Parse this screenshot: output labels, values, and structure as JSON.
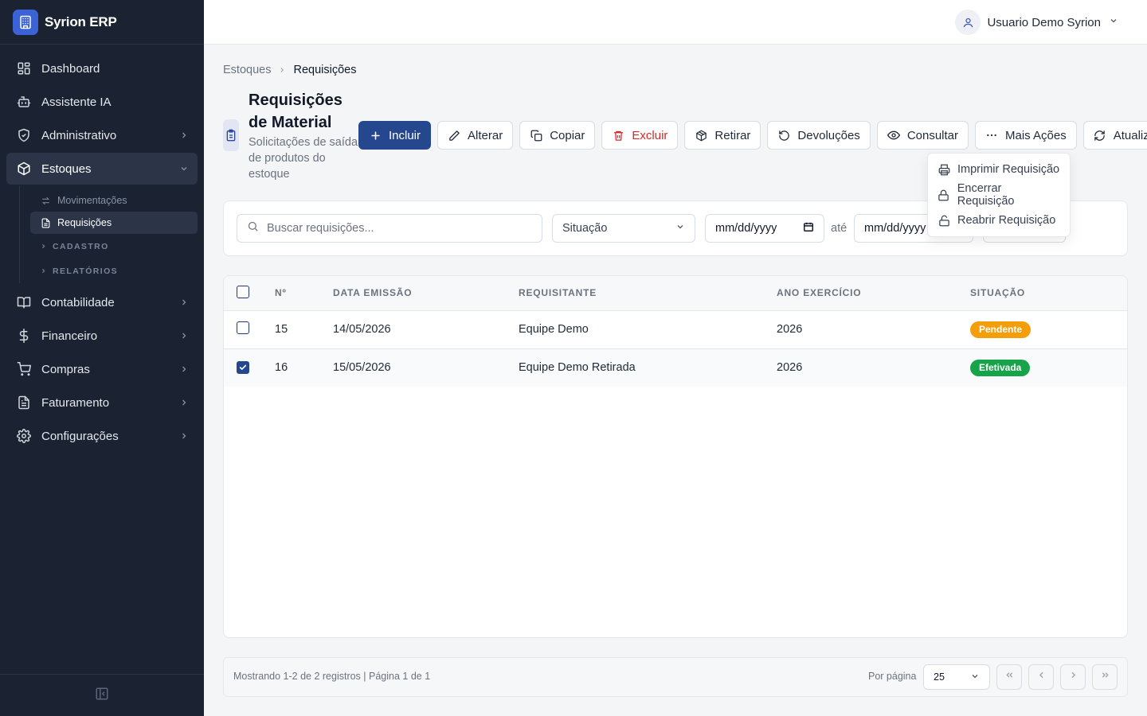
{
  "app": {
    "name": "Syrion ERP"
  },
  "sidebar": {
    "items": [
      {
        "label": "Dashboard",
        "icon": "dashboard-icon"
      },
      {
        "label": "Assistente IA",
        "icon": "bot-icon"
      },
      {
        "label": "Administrativo",
        "icon": "shield-icon"
      },
      {
        "label": "Estoques",
        "icon": "package-icon",
        "expanded": true
      },
      {
        "label": "Contabilidade",
        "icon": "book-icon"
      },
      {
        "label": "Financeiro",
        "icon": "dollar-icon"
      },
      {
        "label": "Compras",
        "icon": "cart-icon"
      },
      {
        "label": "Faturamento",
        "icon": "file-text-icon"
      },
      {
        "label": "Configurações",
        "icon": "gear-icon"
      }
    ],
    "estoques_sub": {
      "movimentacoes": "Movimentações",
      "requisicoes": "Requisições",
      "cadastro": "CADASTRO",
      "relatorios": "RELATÓRIOS"
    }
  },
  "topbar": {
    "user_name": "Usuario Demo Syrion"
  },
  "breadcrumb": {
    "parent": "Estoques",
    "current": "Requisições"
  },
  "page": {
    "title": "Requisições de Material",
    "subtitle_lines": [
      "Solicitações de saída",
      "de produtos do",
      "estoque"
    ]
  },
  "toolbar": {
    "incluir": "Incluir",
    "alterar": "Alterar",
    "copiar": "Copiar",
    "excluir": "Excluir",
    "retirar": "Retirar",
    "devolucoes": "Devoluções",
    "consultar": "Consultar",
    "mais_acoes": "Mais Ações",
    "atualizar": "Atualiza"
  },
  "more_actions_menu": {
    "imprimir": "Imprimir Requisição",
    "encerrar": "Encerrar Requisição",
    "reabrir": "Reabrir Requisição"
  },
  "filters": {
    "search_placeholder": "Buscar requisições...",
    "situacao": "Situação",
    "date_from": "mm/dd/yyyy",
    "date_sep": "até",
    "date_to": "mm/dd/yyyy"
  },
  "table": {
    "columns": [
      "Nº",
      "Data Emissão",
      "Requisitante",
      "Ano Exercício",
      "Situação"
    ],
    "rows": [
      {
        "numero": "15",
        "data": "14/05/2026",
        "requisitante": "Equipe Demo",
        "ano": "2026",
        "situacao": "Pendente",
        "selected": false
      },
      {
        "numero": "16",
        "data": "15/05/2026",
        "requisitante": "Equipe Demo Retirada",
        "ano": "2026",
        "situacao": "Efetivada",
        "selected": true
      }
    ]
  },
  "status_colors": {
    "pendente": "#f59e0b",
    "efetivada": "#16a34a",
    "primary": "#25478e"
  },
  "pagination": {
    "info": "Mostrando 1-2 de 2 registros | Página 1 de 1",
    "per_page_label": "Por página",
    "per_page_value": "25"
  }
}
